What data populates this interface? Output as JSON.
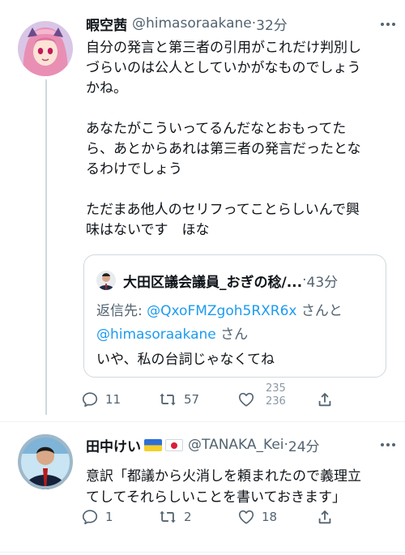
{
  "tweets": [
    {
      "name": "暇空茜",
      "handle": "@himasoraakane",
      "dot": "·",
      "time": "32分",
      "text": "自分の発言と第三者の引用がこれだけ判別し\nづらいのは公人としていかがなものでしょう\nかね。\n\nあなたがこういってるんだなとおもってた\nら、あとからあれは第三者の発言だったとな\nるわけでしょう\n\nただまあ他人のセリフってことらしいんで興\n味はないです　ほな",
      "quote": {
        "name": "大田区議会議員_おぎの稔/...",
        "dot": "·",
        "time": "43分",
        "reply_prefix": "返信先: ",
        "reply_user1": "@QxoFMZgoh5RXR6x",
        "reply_mid": "さんと",
        "reply_user2": "@himasoraakane",
        "reply_suffix": "さん",
        "text": "いや、私の台詞じゃなくてね"
      },
      "actions": {
        "replies": "11",
        "retweets": "57",
        "likes_old": "235",
        "likes_new": "236"
      }
    },
    {
      "name": "田中けい",
      "handle": "@TANAKA_Kei",
      "dot": "·",
      "time": "24分",
      "text": "意訳「都議から火消しを頼まれたので義理立\nてしてそれらしいことを書いておきます」",
      "actions": {
        "replies": "1",
        "retweets": "2",
        "likes": "18"
      }
    }
  ],
  "colors": {
    "text": "#0f1419",
    "secondary": "#536471",
    "link": "#1d9bf0",
    "border": "#cfd9de"
  },
  "icons": [
    "more-icon",
    "reply-icon",
    "retweet-icon",
    "like-icon",
    "share-icon",
    "flag-ukraine-icon",
    "flag-japan-icon"
  ]
}
